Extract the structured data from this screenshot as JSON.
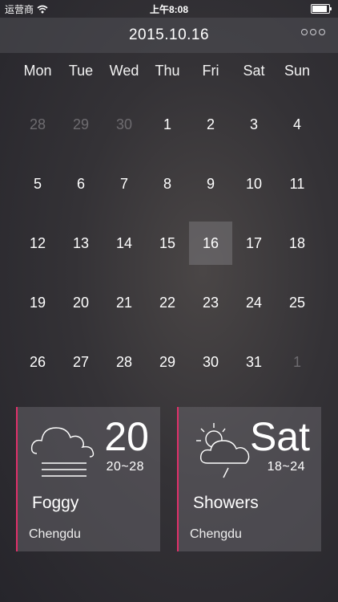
{
  "status": {
    "carrier": "运营商",
    "time": "上午8:08"
  },
  "header": {
    "title": "2015.10.16"
  },
  "weekdays": [
    "Mon",
    "Tue",
    "Wed",
    "Thu",
    "Fri",
    "Sat",
    "Sun"
  ],
  "days": [
    {
      "n": "28",
      "muted": true
    },
    {
      "n": "29",
      "muted": true
    },
    {
      "n": "30",
      "muted": true
    },
    {
      "n": "1"
    },
    {
      "n": "2"
    },
    {
      "n": "3"
    },
    {
      "n": "4"
    },
    {
      "n": "5"
    },
    {
      "n": "6"
    },
    {
      "n": "7"
    },
    {
      "n": "8"
    },
    {
      "n": "9"
    },
    {
      "n": "10"
    },
    {
      "n": "11"
    },
    {
      "n": "12"
    },
    {
      "n": "13"
    },
    {
      "n": "14"
    },
    {
      "n": "15"
    },
    {
      "n": "16",
      "selected": true
    },
    {
      "n": "17"
    },
    {
      "n": "18"
    },
    {
      "n": "19"
    },
    {
      "n": "20"
    },
    {
      "n": "21"
    },
    {
      "n": "22"
    },
    {
      "n": "23"
    },
    {
      "n": "24"
    },
    {
      "n": "25"
    },
    {
      "n": "26"
    },
    {
      "n": "27"
    },
    {
      "n": "28"
    },
    {
      "n": "29"
    },
    {
      "n": "30"
    },
    {
      "n": "31"
    },
    {
      "n": "1",
      "muted": true
    }
  ],
  "cards": [
    {
      "icon": "fog-cloud-icon",
      "big": "20",
      "range": "20~28",
      "condition": "Foggy",
      "city": "Chengdu"
    },
    {
      "icon": "sun-cloud-rain-icon",
      "big": "Sat",
      "range": "18~24",
      "condition": "Showers",
      "city": "Chengdu"
    }
  ],
  "colors": {
    "accent": "#e0306a"
  }
}
